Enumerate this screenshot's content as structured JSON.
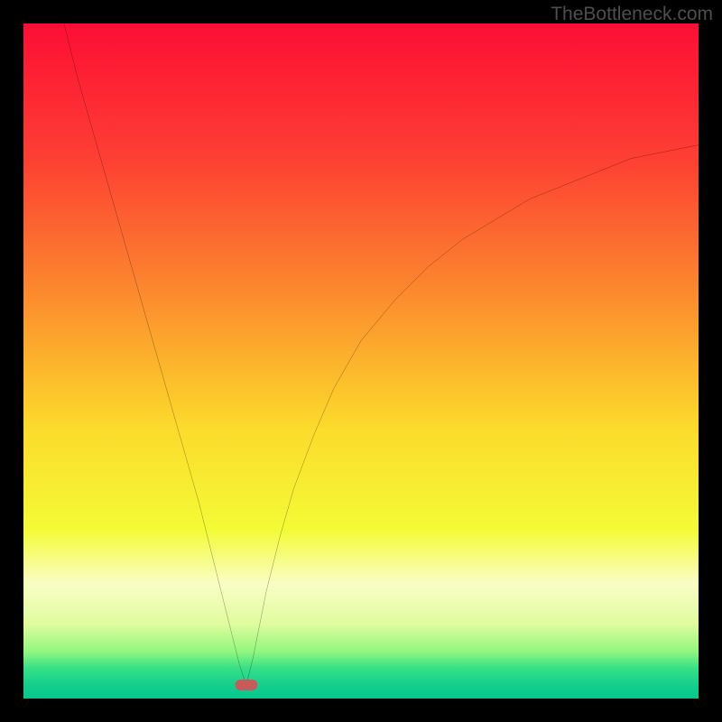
{
  "attribution": "TheBottleneck.com",
  "chart_data": {
    "type": "line",
    "title": "",
    "xlabel": "",
    "ylabel": "",
    "xlim": [
      0,
      100
    ],
    "ylim": [
      0,
      100
    ],
    "minimum_x": 33,
    "minimum_y": 2,
    "marker": {
      "x": 33,
      "y": 2,
      "color": "#c85a5a"
    },
    "left_branch": [
      {
        "x": 6,
        "y": 100
      },
      {
        "x": 8,
        "y": 92
      },
      {
        "x": 10,
        "y": 85
      },
      {
        "x": 12,
        "y": 78
      },
      {
        "x": 14,
        "y": 71
      },
      {
        "x": 16,
        "y": 64
      },
      {
        "x": 18,
        "y": 57
      },
      {
        "x": 20,
        "y": 50
      },
      {
        "x": 22,
        "y": 43
      },
      {
        "x": 24,
        "y": 36
      },
      {
        "x": 26,
        "y": 29
      },
      {
        "x": 28,
        "y": 21
      },
      {
        "x": 30,
        "y": 13
      },
      {
        "x": 31,
        "y": 9
      },
      {
        "x": 32,
        "y": 5
      },
      {
        "x": 33,
        "y": 2
      }
    ],
    "right_branch": [
      {
        "x": 33,
        "y": 2
      },
      {
        "x": 34,
        "y": 6
      },
      {
        "x": 35,
        "y": 11
      },
      {
        "x": 36,
        "y": 16
      },
      {
        "x": 38,
        "y": 24
      },
      {
        "x": 40,
        "y": 31
      },
      {
        "x": 43,
        "y": 39
      },
      {
        "x": 46,
        "y": 46
      },
      {
        "x": 50,
        "y": 53
      },
      {
        "x": 55,
        "y": 59
      },
      {
        "x": 60,
        "y": 64
      },
      {
        "x": 65,
        "y": 68
      },
      {
        "x": 70,
        "y": 71
      },
      {
        "x": 75,
        "y": 74
      },
      {
        "x": 80,
        "y": 76
      },
      {
        "x": 85,
        "y": 78
      },
      {
        "x": 90,
        "y": 80
      },
      {
        "x": 95,
        "y": 81
      },
      {
        "x": 100,
        "y": 82
      }
    ],
    "gradient_stops": [
      {
        "offset": 0.0,
        "color": "#fd0e35"
      },
      {
        "offset": 0.2,
        "color": "#fd3f33"
      },
      {
        "offset": 0.4,
        "color": "#fc8a2e"
      },
      {
        "offset": 0.6,
        "color": "#fcdb2c"
      },
      {
        "offset": 0.75,
        "color": "#f3fb36"
      },
      {
        "offset": 0.83,
        "color": "#fafec5"
      },
      {
        "offset": 0.89,
        "color": "#dffc9e"
      },
      {
        "offset": 0.93,
        "color": "#92f77e"
      },
      {
        "offset": 0.955,
        "color": "#37e087"
      },
      {
        "offset": 0.98,
        "color": "#14cf8c"
      },
      {
        "offset": 1.0,
        "color": "#07c68e"
      }
    ]
  }
}
